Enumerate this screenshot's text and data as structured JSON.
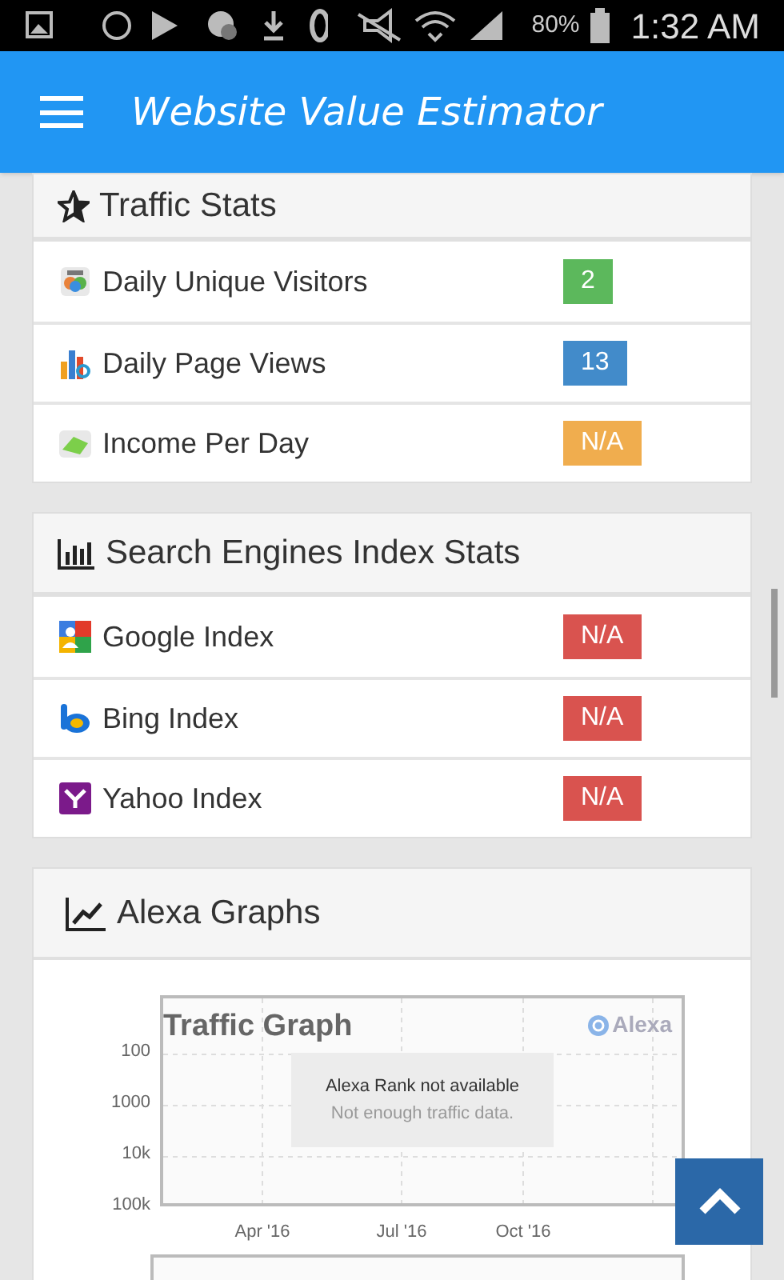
{
  "status_bar": {
    "battery": "80%",
    "time": "1:32 AM"
  },
  "app_bar": {
    "title": "Website Value Estimator"
  },
  "traffic_stats": {
    "title": "Traffic Stats",
    "rows": [
      {
        "label": "Daily Unique Visitors",
        "value": "2",
        "color": "#5cb85c"
      },
      {
        "label": "Daily Page Views",
        "value": "13",
        "color": "#428bca"
      },
      {
        "label": "Income Per Day",
        "value": "N/A",
        "color": "#f0ad4e"
      }
    ]
  },
  "index_stats": {
    "title": "Search Engines Index Stats",
    "rows": [
      {
        "label": "Google Index",
        "value": "N/A",
        "color": "#d9534f"
      },
      {
        "label": "Bing Index",
        "value": "N/A",
        "color": "#d9534f"
      },
      {
        "label": "Yahoo Index",
        "value": "N/A",
        "color": "#d9534f"
      }
    ]
  },
  "alexa_graphs": {
    "title": "Alexa Graphs",
    "traffic_graph": {
      "title": "Traffic Graph",
      "brand": "Alexa",
      "message": "Alexa Rank not available",
      "note": "Not enough traffic data.",
      "y_labels": [
        "100",
        "1000",
        "10k",
        "100k"
      ],
      "x_labels": [
        "Apr '16",
        "Jul '16",
        "Oct '16"
      ]
    }
  }
}
